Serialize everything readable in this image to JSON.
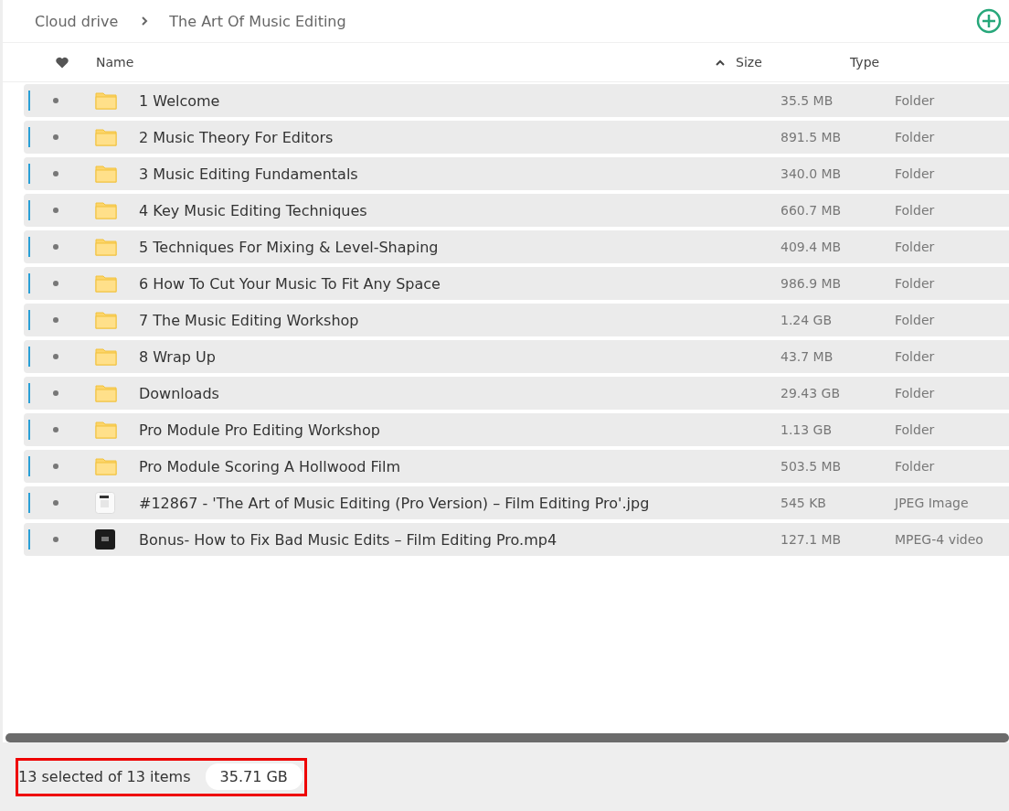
{
  "breadcrumb": [
    "Cloud drive",
    "The Art Of Music Editing"
  ],
  "columns": {
    "name": "Name",
    "size": "Size",
    "type": "Type",
    "sort_ascending": true
  },
  "rows": [
    {
      "kind": "folder",
      "name": "1 Welcome",
      "size": "35.5 MB",
      "type": "Folder",
      "selected": true
    },
    {
      "kind": "folder",
      "name": "2 Music Theory For Editors",
      "size": "891.5 MB",
      "type": "Folder",
      "selected": true
    },
    {
      "kind": "folder",
      "name": "3 Music Editing Fundamentals",
      "size": "340.0 MB",
      "type": "Folder",
      "selected": true
    },
    {
      "kind": "folder",
      "name": "4 Key Music Editing Techniques",
      "size": "660.7 MB",
      "type": "Folder",
      "selected": true
    },
    {
      "kind": "folder",
      "name": "5 Techniques For Mixing & Level-Shaping",
      "size": "409.4 MB",
      "type": "Folder",
      "selected": true
    },
    {
      "kind": "folder",
      "name": "6 How To Cut Your Music To Fit Any Space",
      "size": "986.9 MB",
      "type": "Folder",
      "selected": true
    },
    {
      "kind": "folder",
      "name": "7 The Music Editing Workshop",
      "size": "1.24 GB",
      "type": "Folder",
      "selected": true
    },
    {
      "kind": "folder",
      "name": "8 Wrap Up",
      "size": "43.7 MB",
      "type": "Folder",
      "selected": true
    },
    {
      "kind": "folder",
      "name": "Downloads",
      "size": "29.43 GB",
      "type": "Folder",
      "selected": true
    },
    {
      "kind": "folder",
      "name": "Pro Module Pro Editing Workshop",
      "size": "1.13 GB",
      "type": "Folder",
      "selected": true
    },
    {
      "kind": "folder",
      "name": "Pro Module Scoring A Hollwood Film",
      "size": "503.5 MB",
      "type": "Folder",
      "selected": true
    },
    {
      "kind": "image",
      "name": "#12867 - 'The Art of Music Editing (Pro Version) – Film Editing Pro'.jpg",
      "size": "545 KB",
      "type": "JPEG Image",
      "selected": true
    },
    {
      "kind": "video",
      "name": "Bonus- How to Fix Bad Music Edits – Film Editing Pro.mp4",
      "size": "127.1 MB",
      "type": "MPEG-4 video",
      "selected": true
    }
  ],
  "status_bar": {
    "selection": "13 selected of 13 items",
    "total_size": "35.71 GB",
    "highlighted": true
  }
}
